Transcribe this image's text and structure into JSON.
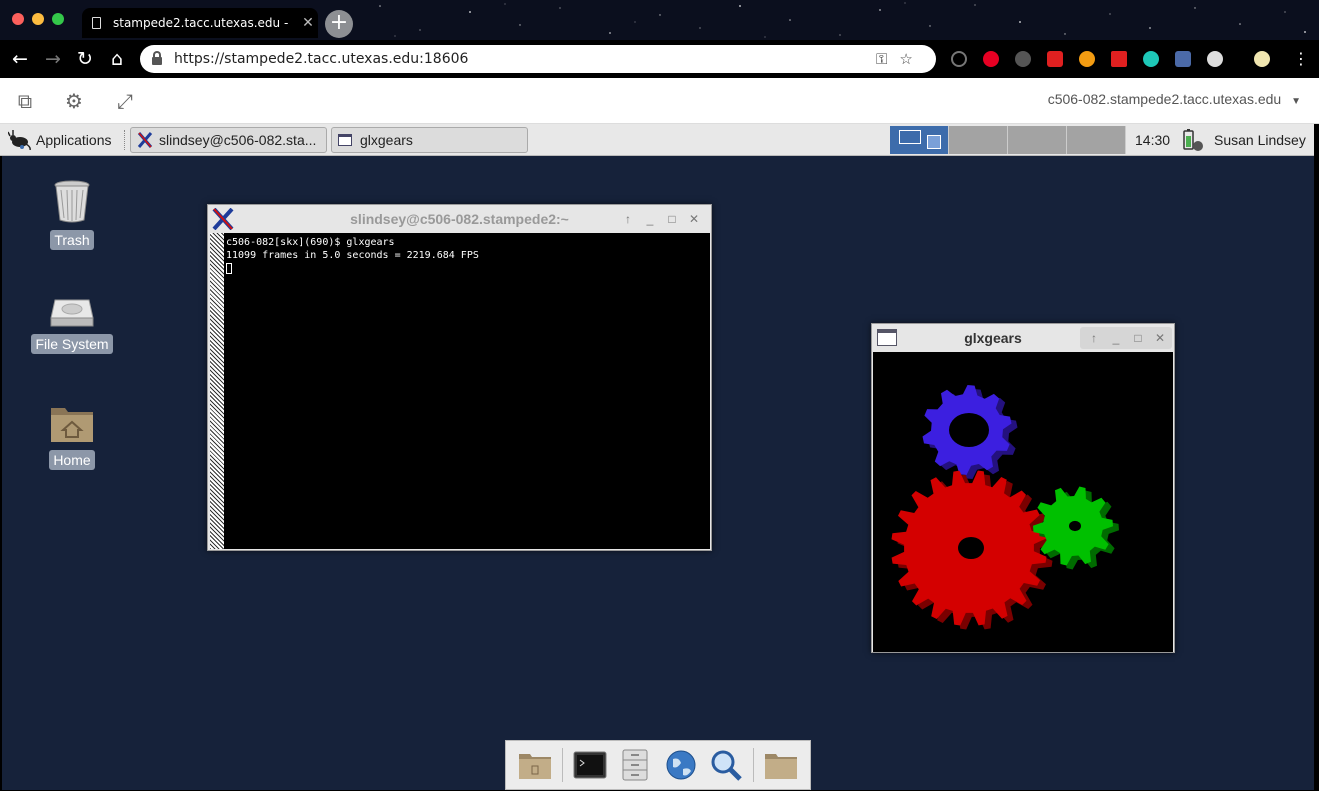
{
  "browser": {
    "tab_title": "stampede2.tacc.utexas.edu - ",
    "url": "https://stampede2.tacc.utexas.edu:18606",
    "traffic_colors": [
      "#fc605c",
      "#fdbc40",
      "#34c84a"
    ]
  },
  "vnc": {
    "host": "c506-082.stampede2.tacc.utexas.edu"
  },
  "panel": {
    "applications_label": "Applications",
    "tasks": [
      {
        "label": "slindsey@c506-082.sta..."
      },
      {
        "label": "glxgears"
      }
    ],
    "workspace_active": 1,
    "clock": "14:30",
    "user": "Susan Lindsey"
  },
  "desktop": {
    "icons": [
      {
        "label": "Trash"
      },
      {
        "label": "File System"
      },
      {
        "label": "Home"
      }
    ]
  },
  "terminal": {
    "title": "slindsey@c506-082.stampede2:~",
    "lines": [
      "c506-082[skx](690)$ glxgears",
      "11099 frames in 5.0 seconds = 2219.684 FPS"
    ]
  },
  "glxgears": {
    "title": "glxgears",
    "gear_colors": {
      "red": "#d40000",
      "green": "#00c000",
      "blue": "#3c1fe0"
    }
  },
  "colors": {
    "desktop_bg": "#16223a",
    "workspace_active": "#3d6cab"
  }
}
